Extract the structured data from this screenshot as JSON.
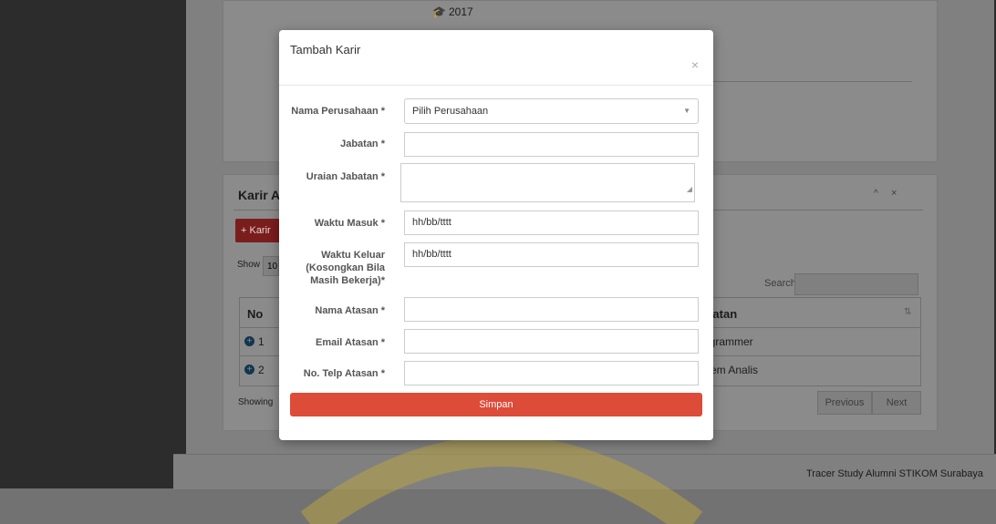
{
  "modal": {
    "title": "Tambah Karir",
    "close": "×",
    "submit": "Simpan",
    "fields": [
      {
        "label": "Nama Perusahaan *",
        "value": "Pilih Perusahaan"
      },
      {
        "label": "Jabatan *",
        "value": ""
      },
      {
        "label": "Uraian Jabatan *",
        "value": ""
      },
      {
        "label": "Waktu Masuk *",
        "value": "hh/bb/tttt"
      },
      {
        "label": "Waktu Keluar (Kosongkan Bila Masih Bekerja)*",
        "value": "hh/bb/tttt"
      },
      {
        "label": "Nama Atasan *",
        "value": ""
      },
      {
        "label": "Email Atasan *",
        "value": ""
      },
      {
        "label": "No. Telp Atasan *",
        "value": ""
      }
    ]
  },
  "background": {
    "year": "2017",
    "panel_title": "Karir A",
    "add_button": "+ Karir",
    "show_label": "Show",
    "show_value": "10",
    "search_label": "Search:",
    "table": {
      "col_no": "No",
      "col_jabatan": "Jabatan",
      "rows": [
        {
          "no": "1",
          "jabatan": "Programmer"
        },
        {
          "no": "2",
          "jabatan": "Sistem Analis"
        }
      ]
    },
    "showing": "Showing",
    "previous": "Previous",
    "next": "Next",
    "footer": "Tracer Study Alumni STIKOM Surabaya"
  }
}
